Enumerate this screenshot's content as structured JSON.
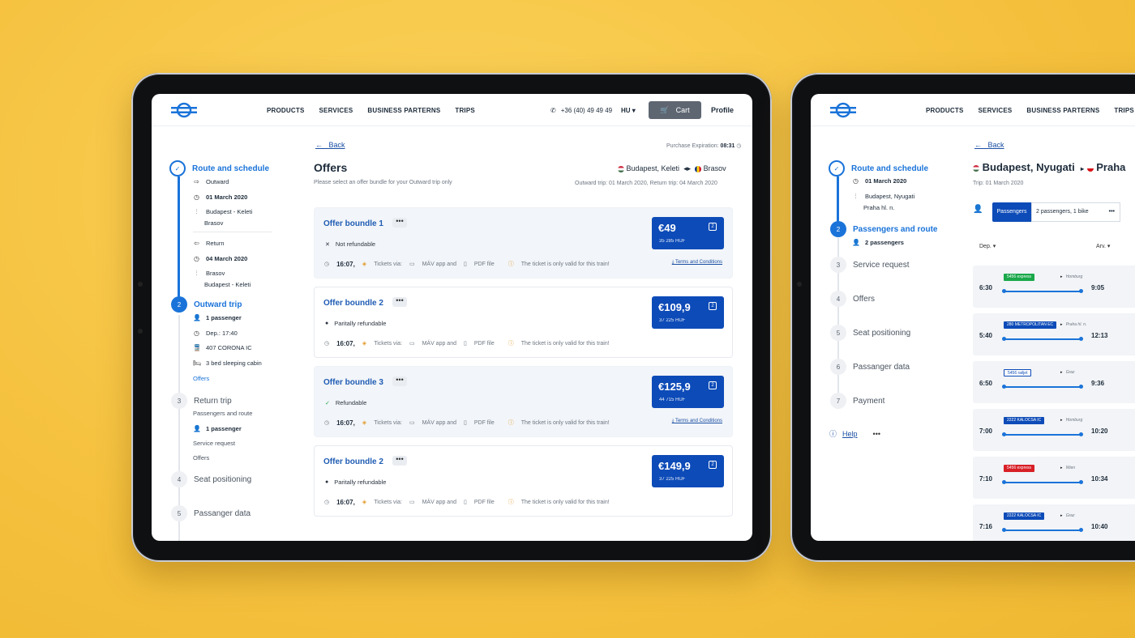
{
  "nav": {
    "products": "PRODUCTS",
    "services": "SERVICES",
    "partners": "BUSINESS PARTERNS",
    "trips": "TRIPS"
  },
  "header": {
    "phone": "+36 (40) 49 49 49",
    "lang": "HU",
    "cart": "Cart",
    "profile": "Profile"
  },
  "left_steps": {
    "s1": "Route and schedule",
    "outward": "Outward",
    "out_date": "01 March 2020",
    "from1": "Budapest - Keleti",
    "to1": "Brasov",
    "return": "Return",
    "ret_date": "04 March 2020",
    "from2": "Brasov",
    "to2": "Budapest - Keleti",
    "s2_num": "2",
    "s2": "Outward trip",
    "pass": "1 passenger",
    "dep": "Dep.: 17:40",
    "train": "407 CORONA IC",
    "cabin": "3 bed sleeping cabin",
    "offers": "Offers",
    "s3_num": "3",
    "s3": "Return trip",
    "pr": "Passengers and route",
    "pass2": "1 passenger",
    "sr": "Service request",
    "offers2": "Offers",
    "s4_num": "4",
    "s4": "Seat positioning",
    "s5_num": "5",
    "s5": "Passanger data"
  },
  "main": {
    "back": "Back",
    "expiry_label": "Purchase Expiration:",
    "expiry": "08:31",
    "title": "Offers",
    "subtitle": "Please select an offer bundle for your Outward trip only",
    "from": "Budapest, Keleti",
    "to": "Brasov",
    "dates": "Outward trip: 01 March 2020,   Return trip: 04 March 2020",
    "tickets_via": "Tickets via:",
    "app": "MÁV app and",
    "pdf": "PDF file",
    "valid": "The ticket is only valid for this train!",
    "terms": "Terms and Conditions",
    "time": "16:07,"
  },
  "offers": [
    {
      "name": "Offer boundle 1",
      "refund": "Not refundable",
      "price": "€49",
      "huf": "35 285 HUF",
      "badge": "2"
    },
    {
      "name": "Offer boundle 2",
      "refund": "Paritally refundable",
      "price": "€109,9",
      "huf": "37 225 HUF",
      "badge": "2"
    },
    {
      "name": "Offer boundle 3",
      "refund": "Refundable",
      "price": "€125,9",
      "huf": "44 715 HUF",
      "badge": "2"
    },
    {
      "name": "Offer boundle 2",
      "refund": "Paritally refundable",
      "price": "€149,9",
      "huf": "37 225 HUF",
      "badge": "2"
    }
  ],
  "right": {
    "s1": "Route and schedule",
    "date": "01 March 2020",
    "from": "Budapest, Nyugati",
    "to": "Praha hl. n.",
    "s2_num": "2",
    "s2": "Passengers and route",
    "pass": "2 passengers",
    "s3_num": "3",
    "s3": "Service request",
    "s4_num": "4",
    "s4": "Offers",
    "s5_num": "5",
    "s5": "Seat positioning",
    "s6_num": "6",
    "s6": "Passanger data",
    "s7_num": "7",
    "s7": "Payment",
    "help": "Help",
    "back": "Back",
    "route_from": "Budapest, Nyugati",
    "route_to": "Praha",
    "trip": "Trip: 01 March 2020",
    "passengers_tab": "Passengers",
    "passengers_val": "2 passengers, 1 bike",
    "dep": "Dep.",
    "arv": "Arv.",
    "rows": [
      {
        "dep": "6:30",
        "arr": "9:05",
        "tag": "5456 express",
        "color": "#1aa84a",
        "dest": "Homburg"
      },
      {
        "dep": "5:40",
        "arr": "12:13",
        "tag": "280 METROPOLITAN EC",
        "color": "#0d4bb8",
        "dest": "Praha hl. n."
      },
      {
        "dep": "6:50",
        "arr": "9:36",
        "tag": "5456 railjet",
        "color": "#ffffff",
        "dest": "Graz"
      },
      {
        "dep": "7:00",
        "arr": "10:20",
        "tag": "2222 KALOCSA IC",
        "color": "#0d4bb8",
        "dest": "Homburg"
      },
      {
        "dep": "7:10",
        "arr": "10:34",
        "tag": "5456 express",
        "color": "#d81f26",
        "dest": "Wien"
      },
      {
        "dep": "7:16",
        "arr": "10:40",
        "tag": "2222 KALOCSA IC",
        "color": "#0d4bb8",
        "dest": "Graz"
      }
    ]
  },
  "colors": {
    "accent": "#1a73d9",
    "price_bg": "#0d4bb8",
    "bg": "#f7c94a"
  }
}
